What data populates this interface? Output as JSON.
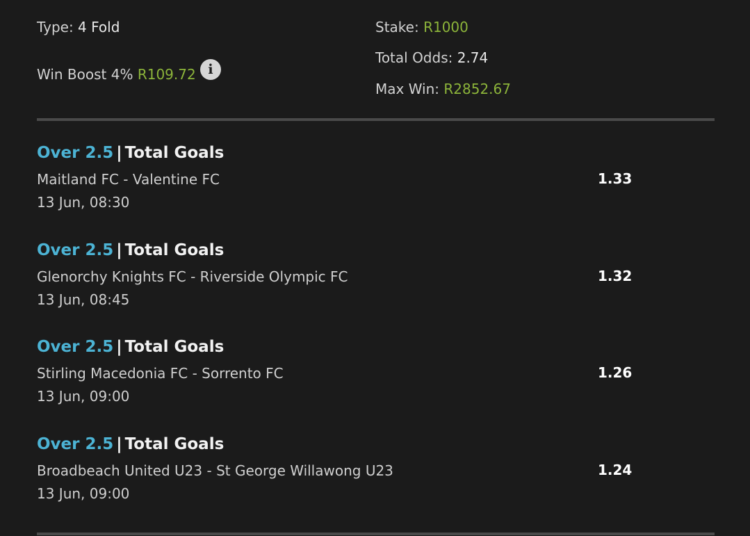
{
  "summary": {
    "type_label": "Type:",
    "type_value": "4 Fold",
    "boost_label": "Win Boost 4%",
    "boost_value": "R109.72",
    "stake_label": "Stake:",
    "stake_value": "R1000",
    "odds_label": "Total Odds:",
    "odds_value": "2.74",
    "maxwin_label": "Max Win:",
    "maxwin_value": "R2852.67",
    "info_icon": "info-icon"
  },
  "legs": [
    {
      "selection": "Over 2.5",
      "separator": "|",
      "market": "Total Goals",
      "match": "Maitland FC - Valentine FC",
      "time": "13 Jun, 08:30",
      "odds": "1.33"
    },
    {
      "selection": "Over 2.5",
      "separator": "|",
      "market": "Total Goals",
      "match": "Glenorchy Knights FC - Riverside Olympic FC",
      "time": "13 Jun, 08:45",
      "odds": "1.32"
    },
    {
      "selection": "Over 2.5",
      "separator": "|",
      "market": "Total Goals",
      "match": "Stirling Macedonia FC - Sorrento FC",
      "time": "13 Jun, 09:00",
      "odds": "1.26"
    },
    {
      "selection": "Over 2.5",
      "separator": "|",
      "market": "Total Goals",
      "match": "Broadbeach United U23 - St George Willawong U23",
      "time": "13 Jun, 09:00",
      "odds": "1.24"
    }
  ],
  "colors": {
    "background": "#1b1b1b",
    "accent_green": "#8cb43a",
    "selection_blue": "#4cb3d4",
    "divider": "#4a4a4a"
  }
}
